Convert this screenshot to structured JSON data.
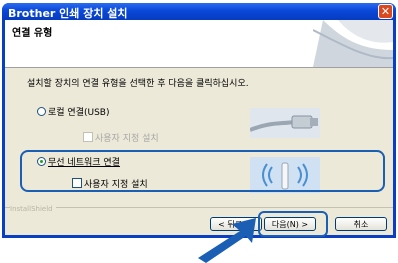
{
  "window": {
    "title": "Brother 인쇄 장치 설치"
  },
  "header": {
    "title": "연결 유형"
  },
  "instruction": "설치할 장치의 연결 유형을 선택한 후 다음을 클릭하십시오.",
  "options": [
    {
      "label": "로컬 연결(USB)",
      "selected": false,
      "custom_label": "사용자 지정 설치",
      "custom_enabled": false
    },
    {
      "label": "무선 네트워크 연결",
      "selected": true,
      "custom_label": "사용자 지정 설치",
      "custom_enabled": true
    }
  ],
  "footer": {
    "brand": "InstallShield",
    "back_label": "< 뒤로(B)",
    "next_label": "다음(N) >",
    "cancel_label": "취소"
  },
  "colors": {
    "accent": "#1a5fb4",
    "titlebar": "#0a48d8"
  }
}
